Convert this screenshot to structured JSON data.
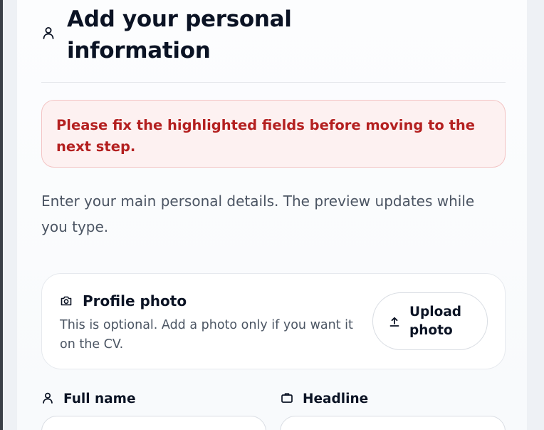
{
  "step": {
    "title": "Add your personal information",
    "icon": "person-icon"
  },
  "error_banner": {
    "message": "Please fix the highlighted fields before moving to the next step.",
    "color": "#b42020",
    "background": "#fdf1f1"
  },
  "intro": {
    "text": "Enter your main personal details. The preview updates while you type."
  },
  "photo_card": {
    "title": "Profile photo",
    "icon": "camera-icon",
    "description": "This is optional. Add a photo only if you want it on the CV.",
    "upload_button": {
      "label": "Upload photo",
      "icon": "upload-icon"
    }
  },
  "fields": {
    "full_name": {
      "label": "Full name",
      "icon": "person-icon",
      "value": ""
    },
    "headline": {
      "label": "Headline",
      "icon": "briefcase-icon",
      "value": ""
    }
  }
}
